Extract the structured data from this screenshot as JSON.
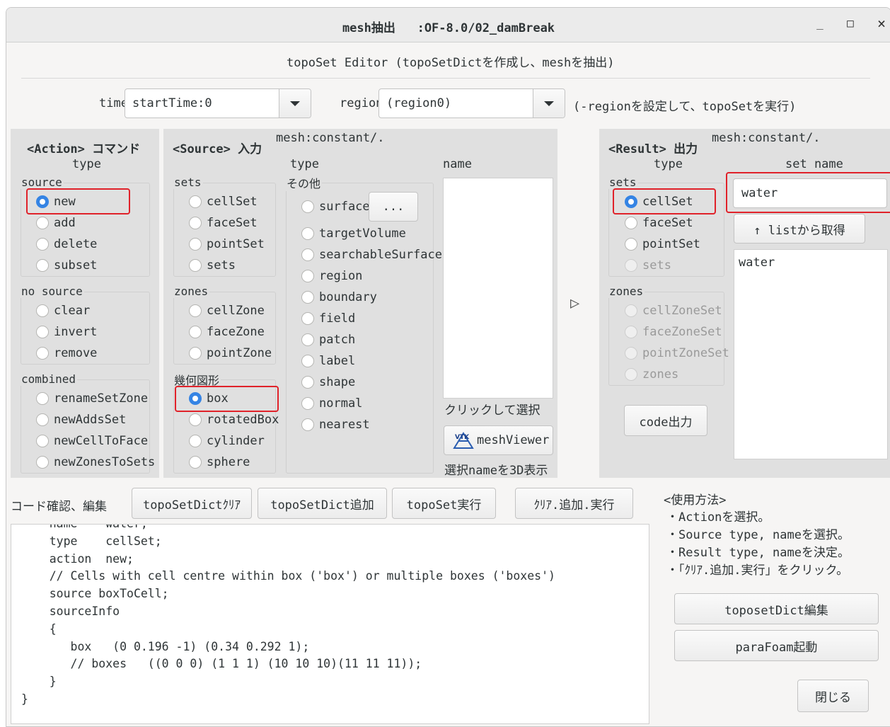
{
  "window": {
    "title": "mesh抽出   :OF-8.0/02_damBreak",
    "minimize": "_",
    "maximize": "□",
    "close": "×"
  },
  "header": {
    "subtitle": "topoSet Editor (topoSetDictを作成し、meshを抽出)"
  },
  "time": {
    "label": "time",
    "value": "startTime:0"
  },
  "region": {
    "label": "region",
    "value": "(region0)",
    "note": "(-regionを設定して、topoSetを実行)"
  },
  "action": {
    "title": "<Action> コマンド",
    "type_label": "type",
    "source_label": "source",
    "source": [
      "new",
      "add",
      "delete",
      "subset"
    ],
    "nosource_label": "no source",
    "nosource": [
      "clear",
      "invert",
      "remove"
    ],
    "combined_label": "combined",
    "combined": [
      "renameSetZone",
      "newAddsSet",
      "newCellToFace",
      "newZonesToSets"
    ],
    "selected": "new"
  },
  "source": {
    "title": "<Source> 入力",
    "mesh": "mesh:constant/.",
    "sets_label": "sets",
    "sets": [
      "cellSet",
      "faceSet",
      "pointSet",
      "sets"
    ],
    "zones_label": "zones",
    "zones": [
      "cellZone",
      "faceZone",
      "pointZone"
    ],
    "geo_label": "幾何図形",
    "geo": [
      "box",
      "rotatedBox",
      "cylinder",
      "sphere"
    ],
    "type_label": "type",
    "other_label": "その他",
    "other": [
      "surface",
      "targetVolume",
      "searchableSurface",
      "region",
      "boundary",
      "field",
      "patch",
      "label",
      "shape",
      "normal",
      "nearest"
    ],
    "surface_btn": "...",
    "name_label": "name",
    "click_hint": "クリックして選択",
    "meshviewer_btn": "meshViewer",
    "viewer_hint": "選択nameを3D表示",
    "selected": "box"
  },
  "arrow": "▷",
  "result": {
    "title": "<Result> 出力",
    "mesh": "mesh:constant/.",
    "type_label": "type",
    "sets_label": "sets",
    "sets": [
      "cellSet",
      "faceSet",
      "pointSet",
      "sets"
    ],
    "zones_label": "zones",
    "zones": [
      "cellZoneSet",
      "faceZoneSet",
      "pointZoneSet",
      "zones"
    ],
    "setname_label": "set name",
    "setname_value": "water",
    "getlist_btn": "↑ listから取得",
    "list": [
      "water"
    ],
    "code_btn": "code出力",
    "selected": "cellSet"
  },
  "toolbar": {
    "label": "コード確認、編集",
    "clear_btn": "topoSetDictｸﾘｱ",
    "add_btn": "topoSetDict追加",
    "run_btn": "topoSet実行",
    "all_btn": "ｸﾘｱ.追加.実行"
  },
  "code": [
    "    name    water;",
    "    type    cellSet;",
    "    action  new;",
    "    // Cells with cell centre within box ('box') or multiple boxes ('boxes')",
    "    source boxToCell;",
    "    sourceInfo",
    "    {",
    "       box   (0 0.196 -1) (0.34 0.292 1);",
    "       // boxes   ((0 0 0) (1 1 1) (10 10 10)(11 11 11));",
    "    }",
    "}"
  ],
  "usage": {
    "title": "<使用方法>",
    "lines": [
      "・Actionを選択。",
      "・Source type, nameを選択。",
      "・Result type, nameを決定。",
      "・「ｸﾘｱ.追加.実行」をクリック。"
    ]
  },
  "side_buttons": {
    "edit": "toposetDict編集",
    "parafoam": "paraFoam起動",
    "close": "閉じる"
  }
}
